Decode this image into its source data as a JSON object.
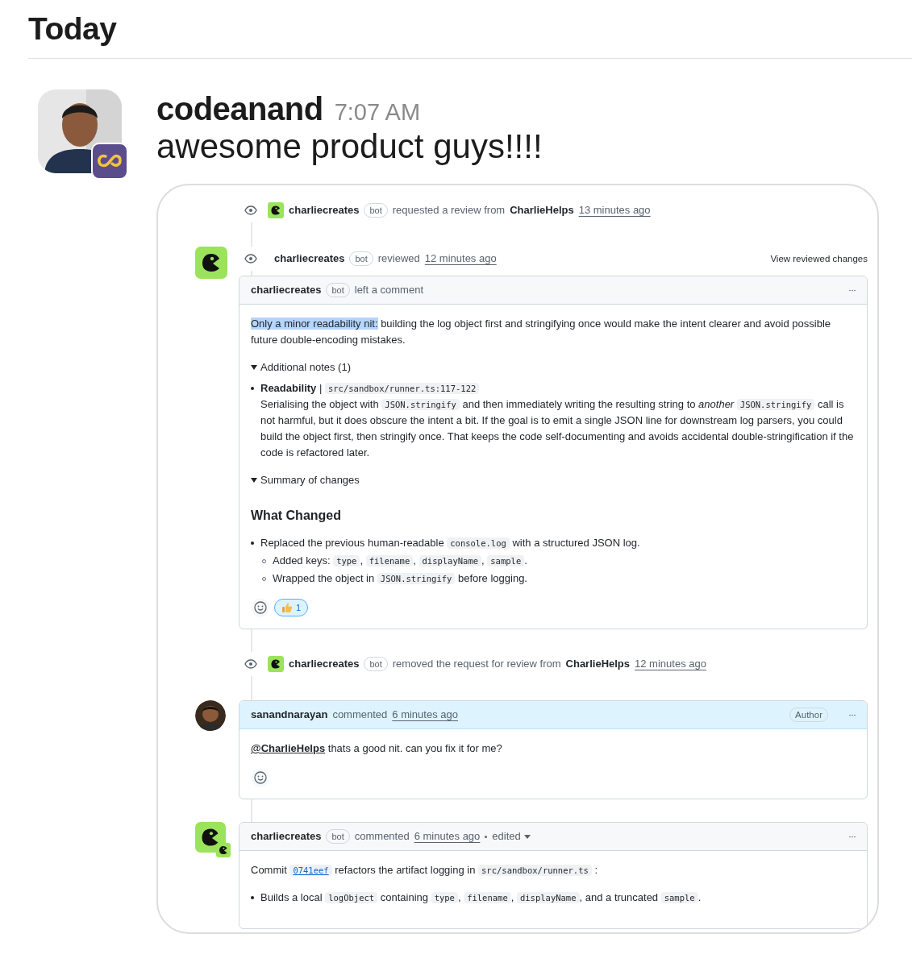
{
  "heading": "Today",
  "message": {
    "author": "codeanand",
    "time": "7:07 AM",
    "text": "awesome product guys!!!!",
    "embed": {
      "timeline": [
        {
          "kind": "event",
          "actor": "charliecreates",
          "badge": "bot",
          "action": "requested a review from",
          "target": "CharlieHelps",
          "time": "13 minutes ago"
        },
        {
          "kind": "review",
          "actor": "charliecreates",
          "badge": "bot",
          "action": "reviewed",
          "time": "12 minutes ago",
          "link": "View reviewed changes",
          "comment": {
            "author": "charliecreates",
            "badge": "bot",
            "action": "left a comment",
            "highlighted": false,
            "body": [
              {
                "kind": "paragraph",
                "parts": [
                  {
                    "kind": "highlight",
                    "text": "Only a minor readability nit:"
                  },
                  {
                    "kind": "text",
                    "text": " building the log object first and stringifying once would make the intent clearer and avoid possible future double-encoding mistakes."
                  }
                ]
              },
              {
                "kind": "details",
                "summary": "Additional notes (1)",
                "expanded": true,
                "blocks": [
                  {
                    "kind": "list",
                    "items": [
                      {
                        "parts": [
                          {
                            "kind": "text",
                            "text": "**Readability** | "
                          },
                          {
                            "kind": "code",
                            "text": "src/sandbox/runner.ts:117-122"
                          },
                          {
                            "kind": "break"
                          },
                          {
                            "kind": "text",
                            "text": "Serialising the object with "
                          },
                          {
                            "kind": "code",
                            "text": "JSON.stringify"
                          },
                          {
                            "kind": "text",
                            "text": " and then immediately writing the resulting string to *another* "
                          },
                          {
                            "kind": "code",
                            "text": "JSON.stringify"
                          },
                          {
                            "kind": "text",
                            "text": " call is not harmful, but it does obscure the intent a bit. If the goal is to emit a single JSON line for downstream log parsers, you could build the object first, then stringify once. That keeps the code self-documenting and avoids accidental double-stringification if the code is refactored later."
                          }
                        ]
                      }
                    ]
                  }
                ]
              },
              {
                "kind": "details",
                "summary": "Summary of changes",
                "expanded": true,
                "blocks": [
                  {
                    "kind": "heading",
                    "text": "What Changed"
                  },
                  {
                    "kind": "list",
                    "items": [
                      {
                        "parts": [
                          {
                            "kind": "text",
                            "text": "Replaced the previous human-readable "
                          },
                          {
                            "kind": "code",
                            "text": "console.log"
                          },
                          {
                            "kind": "text",
                            "text": " with a structured JSON log."
                          }
                        ],
                        "children": [
                          {
                            "parts": [
                              {
                                "kind": "text",
                                "text": "Added keys: "
                              },
                              {
                                "kind": "code",
                                "text": "type"
                              },
                              {
                                "kind": "text",
                                "text": ", "
                              },
                              {
                                "kind": "code",
                                "text": "filename"
                              },
                              {
                                "kind": "text",
                                "text": ", "
                              },
                              {
                                "kind": "code",
                                "text": "displayName"
                              },
                              {
                                "kind": "text",
                                "text": ", "
                              },
                              {
                                "kind": "code",
                                "text": "sample"
                              },
                              {
                                "kind": "text",
                                "text": "."
                              }
                            ]
                          },
                          {
                            "parts": [
                              {
                                "kind": "text",
                                "text": "Wrapped the object in "
                              },
                              {
                                "kind": "code",
                                "text": "JSON.stringify"
                              },
                              {
                                "kind": "text",
                                "text": " before logging."
                              }
                            ]
                          }
                        ]
                      }
                    ]
                  }
                ]
              },
              {
                "kind": "reactions",
                "items": [
                  {
                    "count": "1",
                    "selected": true
                  }
                ]
              }
            ]
          }
        },
        {
          "kind": "event",
          "actor": "charliecreates",
          "badge": "bot",
          "action": "removed the request for review from",
          "target": "CharlieHelps",
          "time": "12 minutes ago"
        },
        {
          "kind": "comment",
          "avatar": {
            "kind": "picture"
          },
          "author": "sanandnarayan",
          "action": "commented",
          "time": "6 minutes ago",
          "role": "Author",
          "highlighted": true,
          "body": [
            {
              "kind": "paragraph",
              "parts": [
                {
                  "kind": "link",
                  "text": "@CharlieHelps"
                },
                {
                  "kind": "text",
                  "text": " thats a good nit. can you fix it for me?"
                }
              ]
            },
            {
              "kind": "reactions"
            }
          ]
        },
        {
          "kind": "comment",
          "avatar": {
            "kind": "bot-app"
          },
          "author": "charliecreates",
          "badge": "bot",
          "action": "commented",
          "time": "6 minutes ago",
          "edited": "edited",
          "highlighted": false,
          "body": [
            {
              "kind": "paragraph",
              "parts": [
                {
                  "kind": "text",
                  "text": "Commit "
                },
                {
                  "kind": "code_link",
                  "text": "0741eef"
                },
                {
                  "kind": "text",
                  "text": " refactors the artifact logging in "
                },
                {
                  "kind": "code",
                  "text": "src/sandbox/runner.ts"
                },
                {
                  "kind": "text",
                  "text": " :"
                }
              ]
            },
            {
              "kind": "list",
              "items": [
                {
                  "parts": [
                    {
                      "kind": "text",
                      "text": "Builds a local "
                    },
                    {
                      "kind": "code",
                      "text": "logObject"
                    },
                    {
                      "kind": "text",
                      "text": " containing "
                    },
                    {
                      "kind": "code",
                      "text": "type"
                    },
                    {
                      "kind": "text",
                      "text": ", "
                    },
                    {
                      "kind": "code",
                      "text": "filename"
                    },
                    {
                      "kind": "text",
                      "text": ", "
                    },
                    {
                      "kind": "code",
                      "text": "displayName"
                    },
                    {
                      "kind": "text",
                      "text": ", and a truncated "
                    },
                    {
                      "kind": "code",
                      "text": "sample"
                    },
                    {
                      "kind": "text",
                      "text": "."
                    }
                  ]
                }
              ]
            }
          ]
        }
      ]
    }
  }
}
